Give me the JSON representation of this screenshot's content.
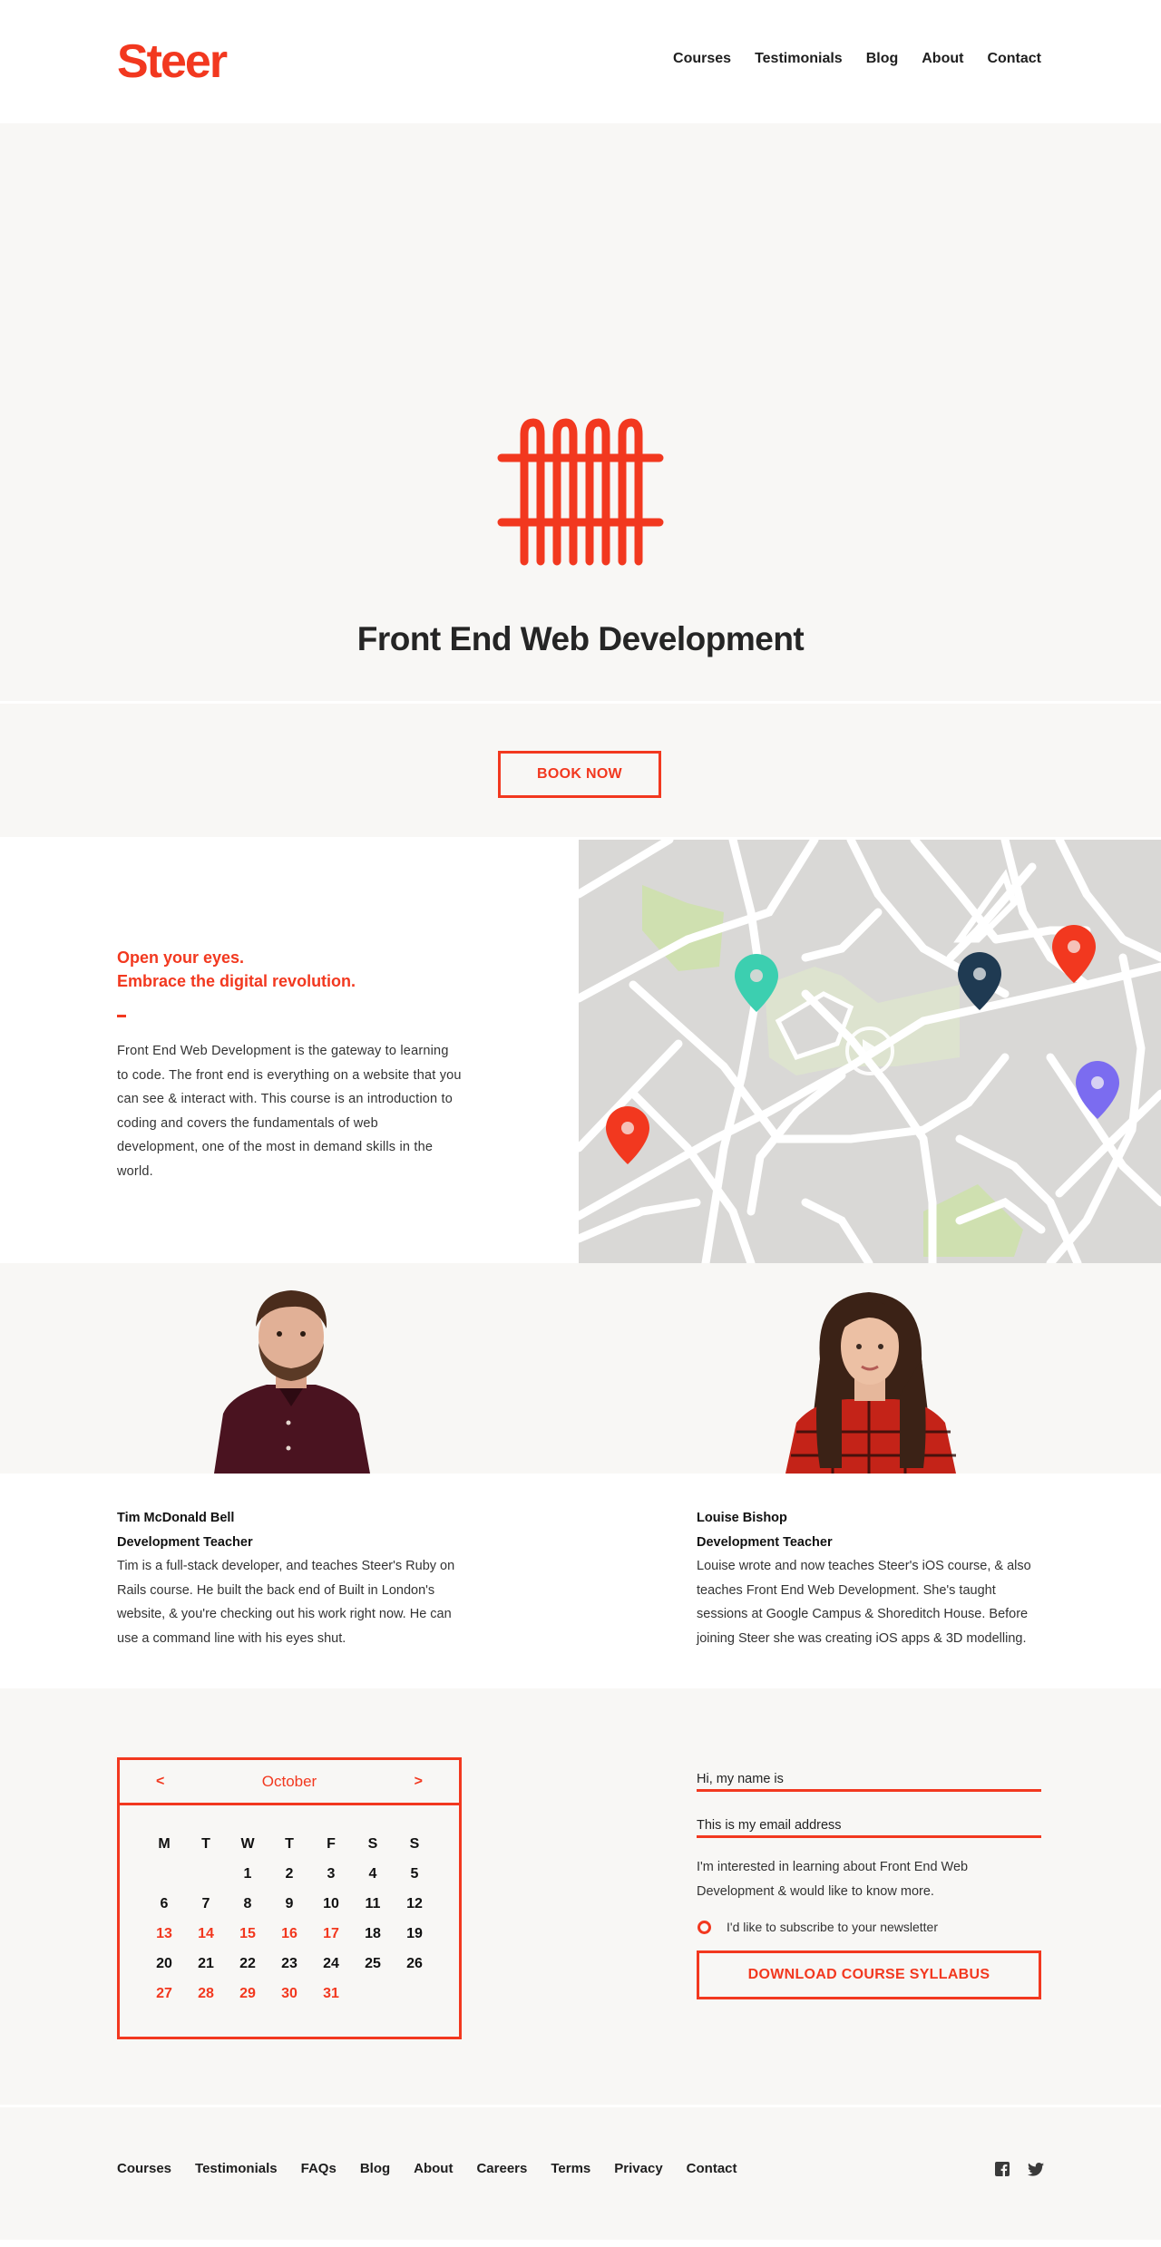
{
  "brand": {
    "logo": "Steer"
  },
  "nav": {
    "items": [
      "Courses",
      "Testimonials",
      "Blog",
      "About",
      "Contact"
    ]
  },
  "hero": {
    "title": "Front End Web Development"
  },
  "book": {
    "label": "BOOK NOW"
  },
  "intro": {
    "headline_1": "Open your eyes.",
    "headline_2": "Embrace the digital revolution.",
    "body": "Front End Web Development is the gateway to learning to code. The front end is everything on a website that you can see & interact with. This course is an introduction to coding and covers the fundamentals of web development, one of the most in demand skills in the world."
  },
  "teachers": [
    {
      "name": "Tim McDonald Bell",
      "role": "Development Teacher",
      "bio": "Tim is a full-stack developer, and teaches Steer's Ruby on Rails course. He built the back end of Built in London's website, & you're checking out his work right now. He can use a command line with his eyes shut."
    },
    {
      "name": "Louise Bishop",
      "role": "Development Teacher",
      "bio": "Louise wrote and now teaches Steer's iOS course, & also teaches Front End Web Development. She's taught sessions at Google Campus & Shoreditch House. Before joining Steer she was creating iOS apps & 3D modelling."
    }
  ],
  "calendar": {
    "month": "October",
    "prev": "<",
    "next": ">",
    "weekdays": [
      "M",
      "T",
      "W",
      "T",
      "F",
      "S",
      "S"
    ],
    "days": [
      "",
      "",
      "1",
      "2",
      "3",
      "4",
      "5",
      "6",
      "7",
      "8",
      "9",
      "10",
      "11",
      "12",
      "13",
      "14",
      "15",
      "16",
      "17",
      "18",
      "19",
      "20",
      "21",
      "22",
      "23",
      "24",
      "25",
      "26",
      "27",
      "28",
      "29",
      "30",
      "31"
    ],
    "highlighted": [
      "13",
      "14",
      "15",
      "16",
      "17",
      "27",
      "28",
      "29",
      "30",
      "31"
    ]
  },
  "form": {
    "name_placeholder": "Hi, my name is",
    "email_placeholder": "This is my email address",
    "note": "I'm interested in learning about Front End Web Development & would like to know more.",
    "subscribe": "I'd like to subscribe to your newsletter",
    "download": "DOWNLOAD COURSE SYLLABUS"
  },
  "footer": {
    "items": [
      "Courses",
      "Testimonials",
      "FAQs",
      "Blog",
      "About",
      "Careers",
      "Terms",
      "Privacy",
      "Contact"
    ],
    "social": [
      "facebook-icon",
      "twitter-icon"
    ]
  },
  "colors": {
    "accent": "#f2381f",
    "bg_light": "#f8f7f5",
    "pin_teal": "#3ccfb0",
    "pin_navy": "#1f3a52",
    "pin_purple": "#7b6cf0",
    "park": "#cfe0b0"
  }
}
